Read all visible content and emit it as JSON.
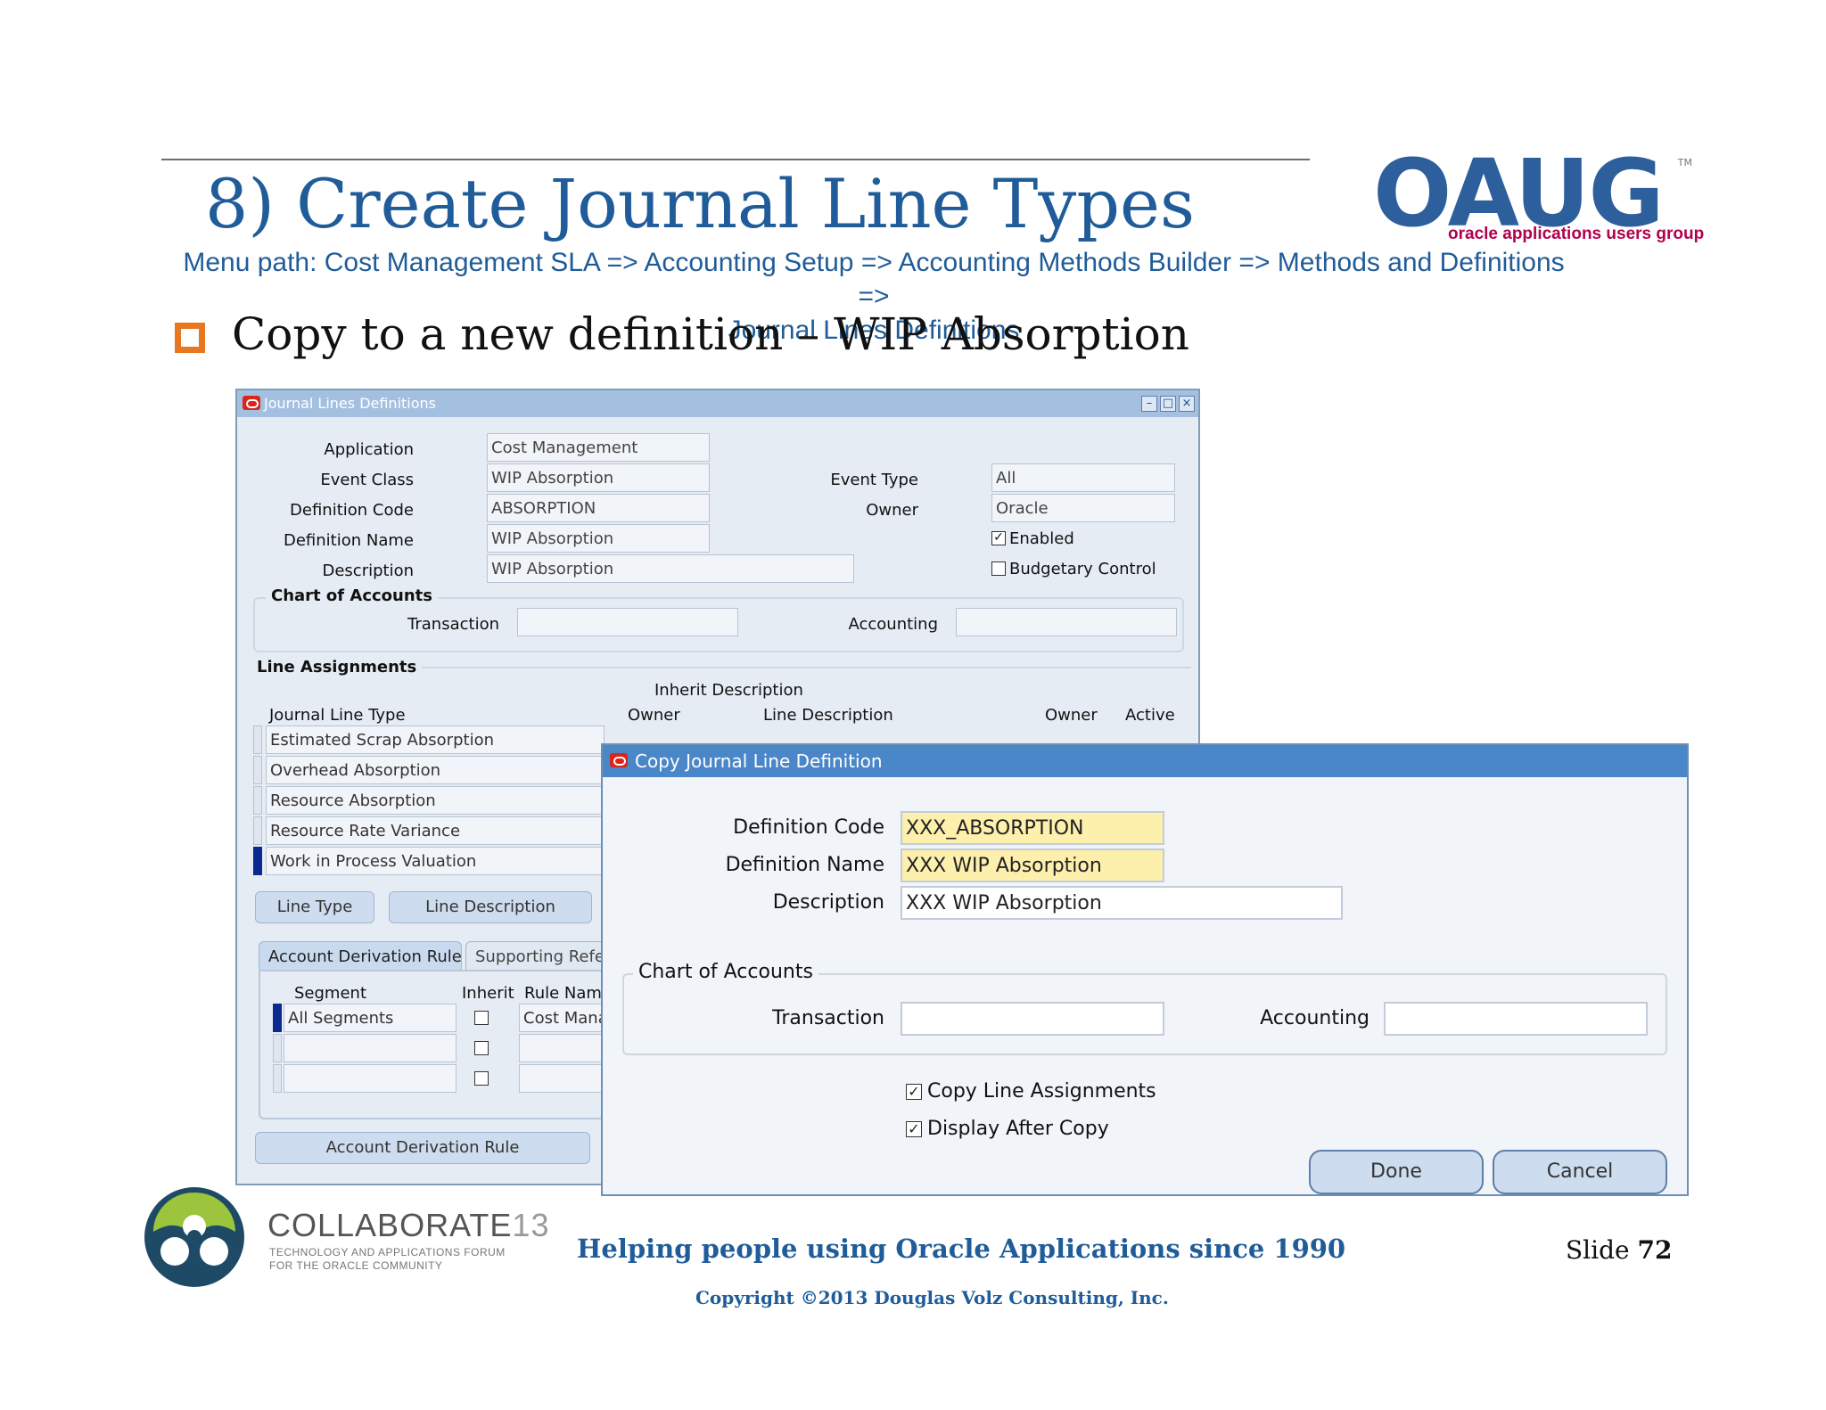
{
  "slide": {
    "title": "8) Create Journal Line Types",
    "menu_path_line1": "Menu path: Cost Management SLA => Accounting Setup => Accounting Methods Builder => Methods and Definitions =>",
    "menu_path_line2": "Journal Lines Definitions",
    "bullet": "Copy to a new definition – WIP Absorption",
    "number_label": "Slide",
    "number": "72"
  },
  "brand": {
    "logo_word": "OAUG",
    "logo_sub": "oracle applications users group",
    "tm": "TM"
  },
  "main_window": {
    "title": "Journal Lines Definitions",
    "fields": {
      "application_label": "Application",
      "application_value": "Cost Management",
      "event_class_label": "Event Class",
      "event_class_value": "WIP Absorption",
      "definition_code_label": "Definition Code",
      "definition_code_value": "ABSORPTION",
      "definition_name_label": "Definition Name",
      "definition_name_value": "WIP Absorption",
      "description_label": "Description",
      "description_value": "WIP Absorption",
      "event_type_label": "Event Type",
      "event_type_value": "All",
      "owner_label": "Owner",
      "owner_value": "Oracle",
      "enabled_label": "Enabled",
      "budgetary_label": "Budgetary Control"
    },
    "coa": {
      "title": "Chart of Accounts",
      "transaction_label": "Transaction",
      "accounting_label": "Accounting"
    },
    "line_assignments": {
      "title": "Line Assignments",
      "col_journal_line_type": "Journal Line Type",
      "col_owner": "Owner",
      "col_inherit_desc": "Inherit Description",
      "col_line_desc": "Line Description",
      "col_owner2": "Owner",
      "col_active": "Active",
      "rows": [
        "Estimated Scrap Absorption",
        "Overhead Absorption",
        "Resource Absorption",
        "Resource Rate Variance",
        "Work in Process Valuation"
      ],
      "btn_line_type": "Line Type",
      "btn_line_desc": "Line Description"
    },
    "tabs": {
      "active": "Account Derivation Rules",
      "inactive": "Supporting References"
    },
    "derivation": {
      "col_segment": "Segment",
      "col_inherit": "Inherit",
      "col_rule_name": "Rule Name",
      "row1_segment": "All Segments",
      "row1_rule": "Cost Management",
      "btn_rule": "Account Derivation Rule"
    }
  },
  "copy_dialog": {
    "title": "Copy Journal Line Definition",
    "definition_code_label": "Definition Code",
    "definition_code_value": "XXX_ABSORPTION",
    "definition_name_label": "Definition Name",
    "definition_name_value": "XXX WIP Absorption",
    "description_label": "Description",
    "description_value": "XXX WIP Absorption",
    "coa_title": "Chart of Accounts",
    "transaction_label": "Transaction",
    "accounting_label": "Accounting",
    "copy_line_assignments": "Copy Line Assignments",
    "display_after_copy": "Display After Copy",
    "done": "Done",
    "cancel": "Cancel"
  },
  "footer": {
    "collab_name": "COLLABORATE",
    "collab_num": "13",
    "collab_sub1": "TECHNOLOGY AND APPLICATIONS FORUM",
    "collab_sub2": "FOR THE ORACLE COMMUNITY",
    "tagline": "Helping people using Oracle Applications since 1990",
    "copyright": "Copyright ©2013 Douglas Volz Consulting, Inc."
  }
}
